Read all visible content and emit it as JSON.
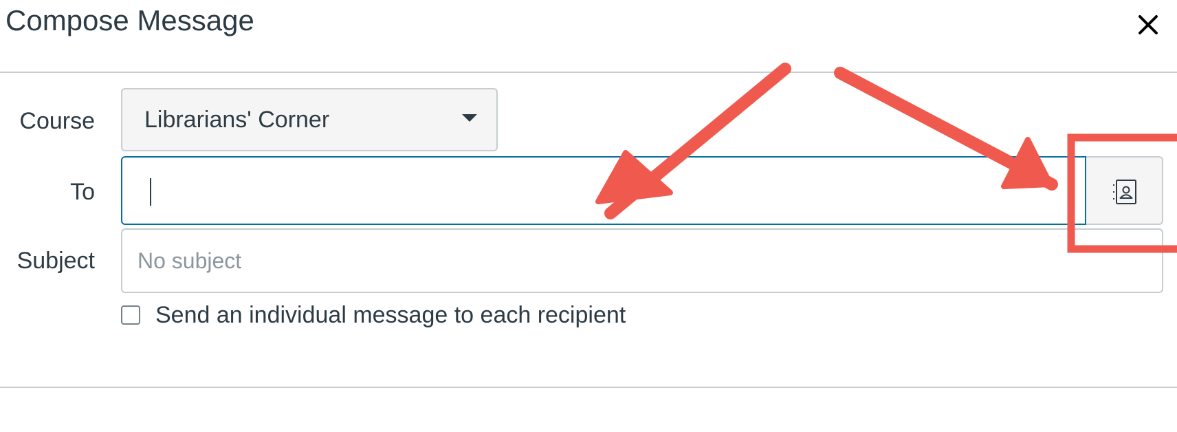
{
  "dialog": {
    "title": "Compose Message",
    "close_icon": "close-icon"
  },
  "form": {
    "course_label": "Course",
    "course_value": "Librarians' Corner",
    "to_label": "To",
    "to_value": "",
    "subject_label": "Subject",
    "subject_placeholder": "No subject",
    "individual_message_label": "Send an individual message to each recipient",
    "individual_message_checked": false,
    "address_book_icon": "address-book-icon"
  },
  "colors": {
    "focus_border": "#0770a3",
    "annotation": "#f05a4e",
    "text": "#2d3b45"
  }
}
